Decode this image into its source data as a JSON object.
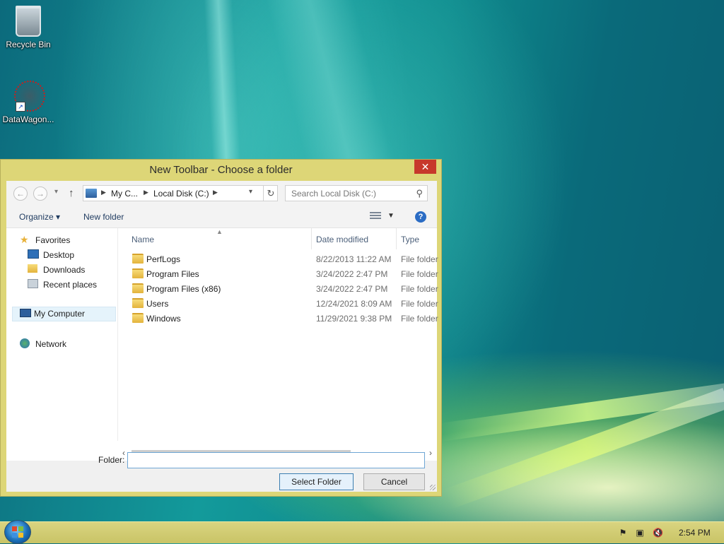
{
  "desktop": {
    "icons": [
      {
        "label": "Recycle Bin",
        "icon": "recycle-bin-icon"
      },
      {
        "label": "DataWagon...",
        "icon": "datawagon-icon"
      }
    ]
  },
  "dialog": {
    "title": "New Toolbar - Choose a folder",
    "close_glyph": "✕",
    "address": {
      "crumbs": [
        "My C...",
        "Local Disk (C:)"
      ],
      "search_placeholder": "Search Local Disk (C:)"
    },
    "toolbar": {
      "organize_label": "Organize ▾",
      "new_folder_label": "New folder"
    },
    "nav_pane": {
      "favorites": {
        "label": "Favorites",
        "items": [
          "Desktop",
          "Downloads",
          "Recent places"
        ]
      },
      "computer": "My Computer",
      "network": "Network"
    },
    "file_list": {
      "columns": [
        "Name",
        "Date modified",
        "Type"
      ],
      "rows": [
        {
          "name": "PerfLogs",
          "date": "8/22/2013 11:22 AM",
          "type": "File folder"
        },
        {
          "name": "Program Files",
          "date": "3/24/2022 2:47 PM",
          "type": "File folder"
        },
        {
          "name": "Program Files (x86)",
          "date": "3/24/2022 2:47 PM",
          "type": "File folder"
        },
        {
          "name": "Users",
          "date": "12/24/2021 8:09 AM",
          "type": "File folder"
        },
        {
          "name": "Windows",
          "date": "11/29/2021 9:38 PM",
          "type": "File folder"
        }
      ]
    },
    "folder_field": {
      "label": "Folder:",
      "value": ""
    },
    "buttons": {
      "select": "Select Folder",
      "cancel": "Cancel"
    }
  },
  "taskbar": {
    "clock": "2:54 PM"
  },
  "colors": {
    "dialog_frame": "#ddd677",
    "close_button": "#c7382b",
    "taskbar": "#d2cd74"
  }
}
